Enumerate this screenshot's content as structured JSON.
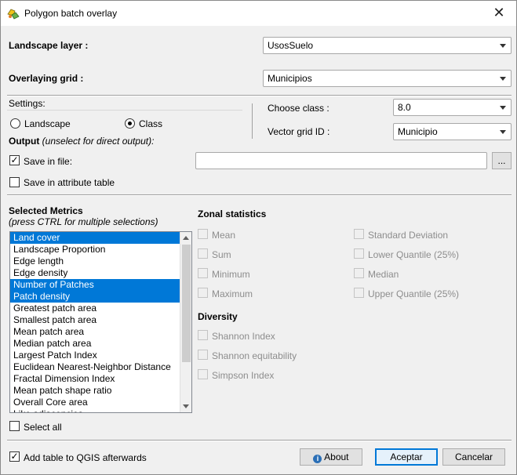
{
  "window": {
    "title": "Polygon batch overlay",
    "close_glyph": "✕"
  },
  "landscape_layer": {
    "label": "Landscape layer :",
    "value": "UsosSuelo"
  },
  "overlaying_grid": {
    "label": "Overlaying grid :",
    "value": "Municipios"
  },
  "settings": {
    "label": "Settings:",
    "radio_landscape": "Landscape",
    "radio_class": "Class",
    "selected": "Class",
    "choose_class_label": "Choose class :",
    "choose_class_value": "8.0",
    "vector_grid_id_label": "Vector grid ID :",
    "vector_grid_id_value": "Municipio"
  },
  "output": {
    "label": "Output",
    "hint": "(unselect for direct output):",
    "save_in_file": "Save in file:",
    "save_in_file_checked": true,
    "file_path": "",
    "browse_label": "...",
    "save_in_attribute_table": "Save in attribute table"
  },
  "metrics": {
    "label": "Selected Metrics",
    "hint": "(press CTRL for multiple selections)",
    "items": [
      {
        "label": "Land cover",
        "selected": true
      },
      {
        "label": "Landscape Proportion",
        "selected": false
      },
      {
        "label": "Edge length",
        "selected": false
      },
      {
        "label": "Edge density",
        "selected": false
      },
      {
        "label": "Number of Patches",
        "selected": true
      },
      {
        "label": "Patch density",
        "selected": true
      },
      {
        "label": "Greatest patch area",
        "selected": false
      },
      {
        "label": "Smallest patch area",
        "selected": false
      },
      {
        "label": "Mean patch area",
        "selected": false
      },
      {
        "label": "Median patch area",
        "selected": false
      },
      {
        "label": "Largest Patch Index",
        "selected": false
      },
      {
        "label": "Euclidean Nearest-Neighbor Distance",
        "selected": false
      },
      {
        "label": "Fractal Dimension Index",
        "selected": false
      },
      {
        "label": "Mean patch shape ratio",
        "selected": false
      },
      {
        "label": "Overall Core area",
        "selected": false
      },
      {
        "label": "Like adjacencies",
        "selected": false
      }
    ],
    "select_all": "Select all"
  },
  "zonal": {
    "label": "Zonal statistics",
    "left": [
      "Mean",
      "Sum",
      "Minimum",
      "Maximum"
    ],
    "right": [
      "Standard Deviation",
      "Lower Quantile (25%)",
      "Median",
      "Upper Quantile (25%)"
    ]
  },
  "diversity": {
    "label": "Diversity",
    "items": [
      "Shannon Index",
      "Shannon equitability",
      "Simpson Index"
    ]
  },
  "footer": {
    "add_table": "Add table to QGIS afterwards",
    "add_table_checked": true,
    "about": "About",
    "accept": "Aceptar",
    "cancel": "Cancelar"
  },
  "colors": {
    "selection": "#0078d7",
    "accent": "#0078d7"
  }
}
